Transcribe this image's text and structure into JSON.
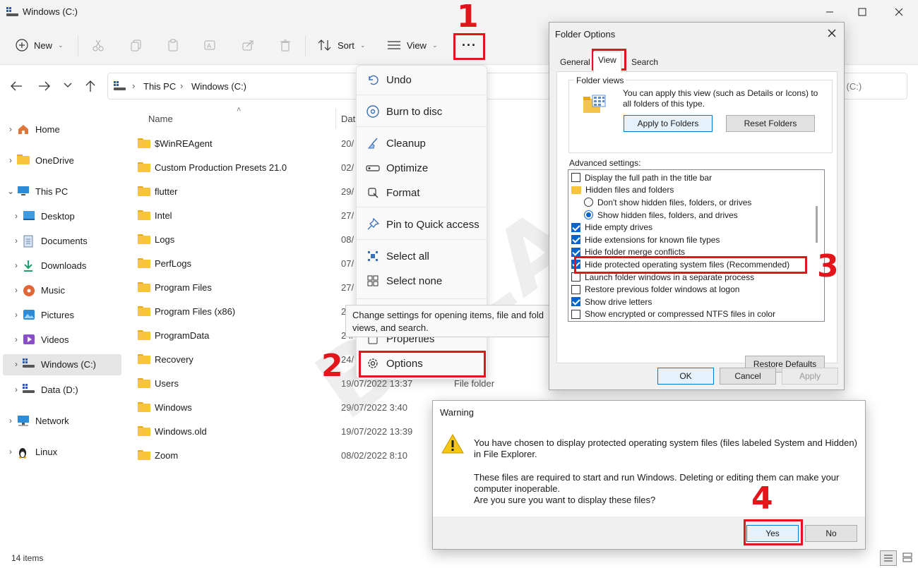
{
  "window": {
    "title": "Windows (C:)"
  },
  "toolbar": {
    "new_label": "New",
    "sort_label": "Sort",
    "view_label": "View",
    "more_label": "···"
  },
  "address": {
    "root": "This PC",
    "current": "Windows (C:)",
    "search_tail": "ws (C:)"
  },
  "nav": {
    "items": [
      {
        "label": "Home",
        "icon": "home-icon",
        "level": 0
      },
      {
        "label": "OneDrive",
        "icon": "folder-icon",
        "level": 0
      },
      {
        "label": "This PC",
        "icon": "monitor-icon",
        "level": 0
      },
      {
        "label": "Desktop",
        "icon": "desktop-icon",
        "level": 1
      },
      {
        "label": "Documents",
        "icon": "documents-icon",
        "level": 1
      },
      {
        "label": "Downloads",
        "icon": "downloads-icon",
        "level": 1
      },
      {
        "label": "Music",
        "icon": "music-icon",
        "level": 1
      },
      {
        "label": "Pictures",
        "icon": "pictures-icon",
        "level": 1
      },
      {
        "label": "Videos",
        "icon": "videos-icon",
        "level": 1
      },
      {
        "label": "Windows (C:)",
        "icon": "drive-icon",
        "level": 1
      },
      {
        "label": "Data (D:)",
        "icon": "drive-icon",
        "level": 1
      },
      {
        "label": "Network",
        "icon": "network-icon",
        "level": 0
      },
      {
        "label": "Linux",
        "icon": "linux-icon",
        "level": 0
      }
    ]
  },
  "files": {
    "columns": {
      "name": "Name",
      "date": "Dat"
    },
    "rows": [
      {
        "name": "$WinREAgent",
        "date": "20/",
        "type": "er"
      },
      {
        "name": "Custom Production Presets 21.0",
        "date": "02/",
        "type": "er"
      },
      {
        "name": "flutter",
        "date": "29/",
        "type": "er"
      },
      {
        "name": "Intel",
        "date": "27/",
        "type": "er"
      },
      {
        "name": "Logs",
        "date": "08/",
        "type": "er"
      },
      {
        "name": "PerfLogs",
        "date": "07/",
        "type": "er"
      },
      {
        "name": "Program Files",
        "date": "27/",
        "type": "er"
      },
      {
        "name": "Program Files (x86)",
        "date": "24/",
        "type": "er"
      },
      {
        "name": "ProgramData",
        "date": "24/",
        "type": "er"
      },
      {
        "name": "Recovery",
        "date": "24/",
        "type": "er"
      },
      {
        "name": "Users",
        "date": "19/07/2022 13:37",
        "type": "File folder"
      },
      {
        "name": "Windows",
        "date": "29/07/2022 3:40",
        "type": ""
      },
      {
        "name": "Windows.old",
        "date": "19/07/2022 13:39",
        "type": ""
      },
      {
        "name": "Zoom",
        "date": "08/02/2022 8:10",
        "type": ""
      }
    ],
    "item_count": "14 items"
  },
  "menu": {
    "items": [
      {
        "label": "Undo",
        "icon": "undo-icon"
      },
      {
        "label": "Burn to disc",
        "icon": "disc-icon"
      },
      {
        "label": "Cleanup",
        "icon": "broom-icon"
      },
      {
        "label": "Optimize",
        "icon": "optimize-icon"
      },
      {
        "label": "Format",
        "icon": "format-icon"
      },
      {
        "label": "Pin to Quick access",
        "icon": "pin-icon"
      },
      {
        "label": "Select all",
        "icon": "select-all-icon"
      },
      {
        "label": "Select none",
        "icon": "select-none-icon"
      },
      {
        "label": "Properties",
        "icon": "properties-icon"
      },
      {
        "label": "Options",
        "icon": "gear-icon"
      }
    ],
    "tooltip_line1": "Change settings for opening items, file and fold",
    "tooltip_line2": "views, and search."
  },
  "folder_options": {
    "title": "Folder Options",
    "tabs": [
      "General",
      "View",
      "Search"
    ],
    "folder_views_label": "Folder views",
    "folder_views_text": "You can apply this view (such as Details or Icons) to all folders of this type.",
    "apply_button": "Apply to Folders",
    "reset_button": "Reset Folders",
    "advanced_label": "Advanced settings:",
    "advanced": [
      {
        "kind": "checkbox",
        "checked": false,
        "label": "Display the full path in the title bar",
        "indent": 0
      },
      {
        "kind": "folder",
        "checked": false,
        "label": "Hidden files and folders",
        "indent": 0
      },
      {
        "kind": "radio",
        "checked": false,
        "label": "Don't show hidden files, folders, or drives",
        "indent": 1
      },
      {
        "kind": "radio",
        "checked": true,
        "label": "Show hidden files, folders, and drives",
        "indent": 1
      },
      {
        "kind": "checkbox",
        "checked": true,
        "label": "Hide empty drives",
        "indent": 0
      },
      {
        "kind": "checkbox",
        "checked": true,
        "label": "Hide extensions for known file types",
        "indent": 0
      },
      {
        "kind": "checkbox",
        "checked": true,
        "label": "Hide folder merge conflicts",
        "indent": 0
      },
      {
        "kind": "checkbox",
        "checked": true,
        "label": "Hide protected operating system files (Recommended)",
        "indent": 0
      },
      {
        "kind": "checkbox",
        "checked": false,
        "label": "Launch folder windows in a separate process",
        "indent": 0
      },
      {
        "kind": "checkbox",
        "checked": false,
        "label": "Restore previous folder windows at logon",
        "indent": 0
      },
      {
        "kind": "checkbox",
        "checked": true,
        "label": "Show drive letters",
        "indent": 0
      },
      {
        "kind": "checkbox",
        "checked": false,
        "label": "Show encrypted or compressed NTFS files in color",
        "indent": 0
      }
    ],
    "restore_defaults": "Restore Defaults",
    "ok": "OK",
    "cancel": "Cancel",
    "apply": "Apply"
  },
  "warning": {
    "title": "Warning",
    "line1": "You have chosen to display protected operating system files (files labeled System and Hidden)",
    "line2": "in File Explorer.",
    "line3": "These files are required to start and run Windows. Deleting or editing them can make your",
    "line4": "computer inoperable.",
    "line5": "Are you sure you want to display these files?",
    "yes": "Yes",
    "no": "No"
  },
  "steps": [
    "1",
    "2",
    "3",
    "4"
  ],
  "colors": {
    "annotation_red": "#e4141b",
    "accent_blue": "#0a64c8",
    "folder_yellow": "#f8c43c"
  }
}
